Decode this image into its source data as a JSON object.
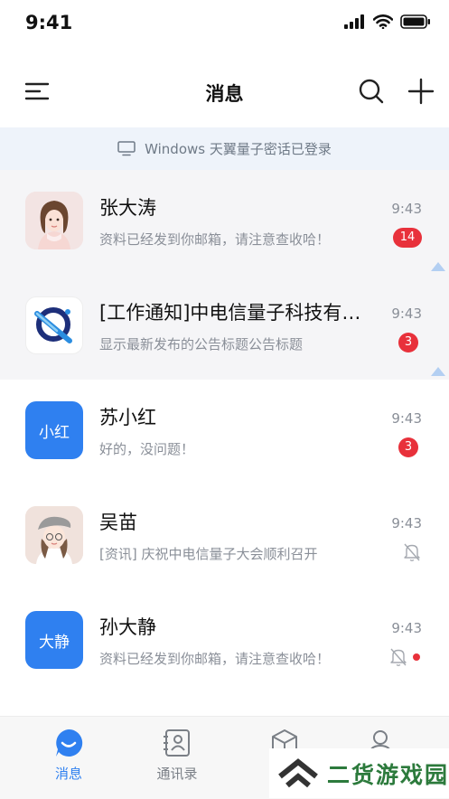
{
  "status_bar": {
    "time": "9:41"
  },
  "header": {
    "title": "消息"
  },
  "login_banner": {
    "text": "Windows 天翼量子密话已登录"
  },
  "conversations": [
    {
      "name": "张大涛",
      "preview": "资料已经发到你邮箱，请注意查收哈！",
      "time": "9:43",
      "badge": "14",
      "pinned": true
    },
    {
      "name": "[工作通知]中电信量子科技有限公司",
      "preview": "显示最新发布的公告标题公告标题",
      "time": "9:43",
      "badge": "3",
      "pinned": true
    },
    {
      "name": "苏小红",
      "avatar_text": "小红",
      "preview": "好的，没问题！",
      "time": "9:43",
      "badge": "3"
    },
    {
      "name": "吴苗",
      "preview": "[资讯] 庆祝中电信量子大会顺利召开",
      "time": "9:43",
      "muted": true
    },
    {
      "name": "孙大静",
      "avatar_text": "大静",
      "preview": "资料已经发到你邮箱，请注意查收哈！",
      "time": "9:43",
      "muted": true,
      "dot": true
    }
  ],
  "tab_bar": {
    "tabs": [
      {
        "label": "消息",
        "icon": "chat-bubble-icon",
        "active": true
      },
      {
        "label": "通讯录",
        "icon": "contacts-icon"
      },
      {
        "label": "",
        "icon": "cube-icon"
      },
      {
        "label": "",
        "icon": "person-icon"
      }
    ]
  },
  "watermark": {
    "text": "二货游戏园"
  },
  "colors": {
    "accent": "#2f80f0",
    "badge": "#e8313b",
    "banner_bg": "#eef3fa",
    "pinned_bg": "#f5f5f7",
    "watermark": "#2c7a3c"
  }
}
